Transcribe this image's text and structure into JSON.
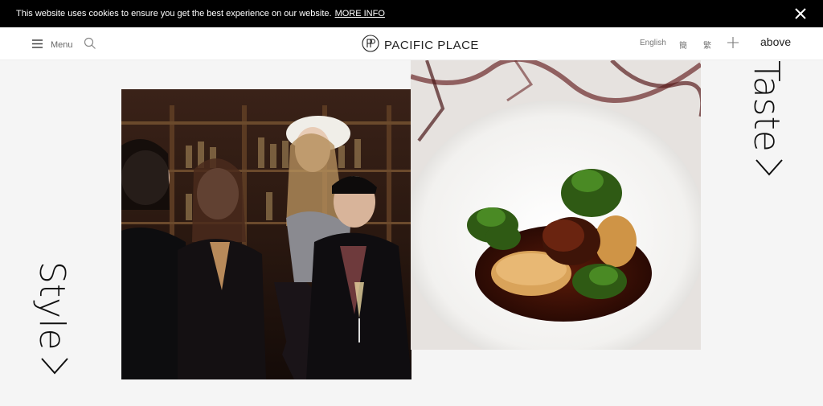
{
  "cookie": {
    "message": "This website uses cookies to ensure you get the best experience on our website.",
    "link": "MORE INFO"
  },
  "header": {
    "menu_label": "Menu",
    "logo_text": "PACIFIC PLACE",
    "languages": [
      "English",
      "簡",
      "繁"
    ],
    "above_label": "above"
  },
  "sections": {
    "taste_label": "Taste",
    "style_label": "Style"
  },
  "icons": {
    "menu": "hamburger-icon",
    "search": "search-icon",
    "plus": "plus-icon",
    "close": "close-icon",
    "chevron": "chevron-right-icon",
    "logo": "pacific-place-monogram-icon"
  }
}
